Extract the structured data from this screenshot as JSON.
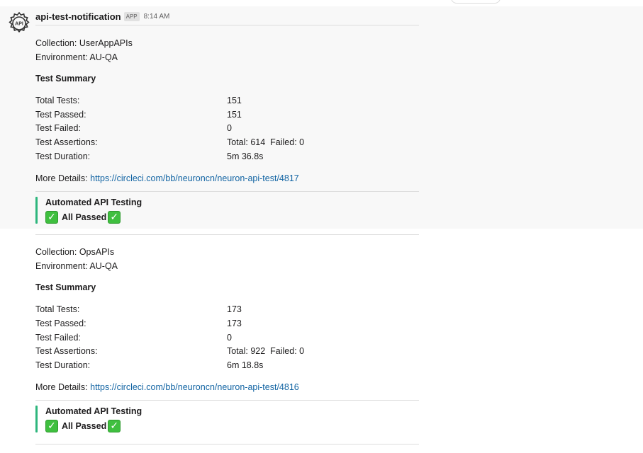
{
  "message": {
    "sender": "api-test-notification",
    "badge": "APP",
    "time": "8:14 AM",
    "avatar_text": "API"
  },
  "reports": [
    {
      "collection": "Collection: UserAppAPIs",
      "environment": "Environment: AU-QA",
      "summary_title": "Test Summary",
      "rows": [
        {
          "label": "Total Tests:",
          "value": "151"
        },
        {
          "label": "Test Passed:",
          "value": "151"
        },
        {
          "label": "Test Failed:",
          "value": "0"
        },
        {
          "label": "Test Assertions:",
          "value": "Total: 614  Failed: 0"
        },
        {
          "label": "Test Duration:",
          "value": "5m 36.8s"
        }
      ],
      "more_label": "More Details:",
      "more_link": "https://circleci.com/bb/neuroncn/neuron-api-test/4817",
      "attachment_title": "Automated API Testing",
      "attachment_text": "All Passed",
      "check_icon": "white-heavy-check-mark-icon",
      "accent_color": "#2eb67d"
    },
    {
      "collection": "Collection: OpsAPIs",
      "environment": "Environment: AU-QA",
      "summary_title": "Test Summary",
      "rows": [
        {
          "label": "Total Tests:",
          "value": "173"
        },
        {
          "label": "Test Passed:",
          "value": "173"
        },
        {
          "label": "Test Failed:",
          "value": "0"
        },
        {
          "label": "Test Assertions:",
          "value": "Total: 922  Failed: 0"
        },
        {
          "label": "Test Duration:",
          "value": "6m 18.8s"
        }
      ],
      "more_label": "More Details:",
      "more_link": "https://circleci.com/bb/neuroncn/neuron-api-test/4816",
      "attachment_title": "Automated API Testing",
      "attachment_text": "All Passed",
      "check_icon": "white-heavy-check-mark-icon",
      "accent_color": "#2eb67d"
    }
  ]
}
